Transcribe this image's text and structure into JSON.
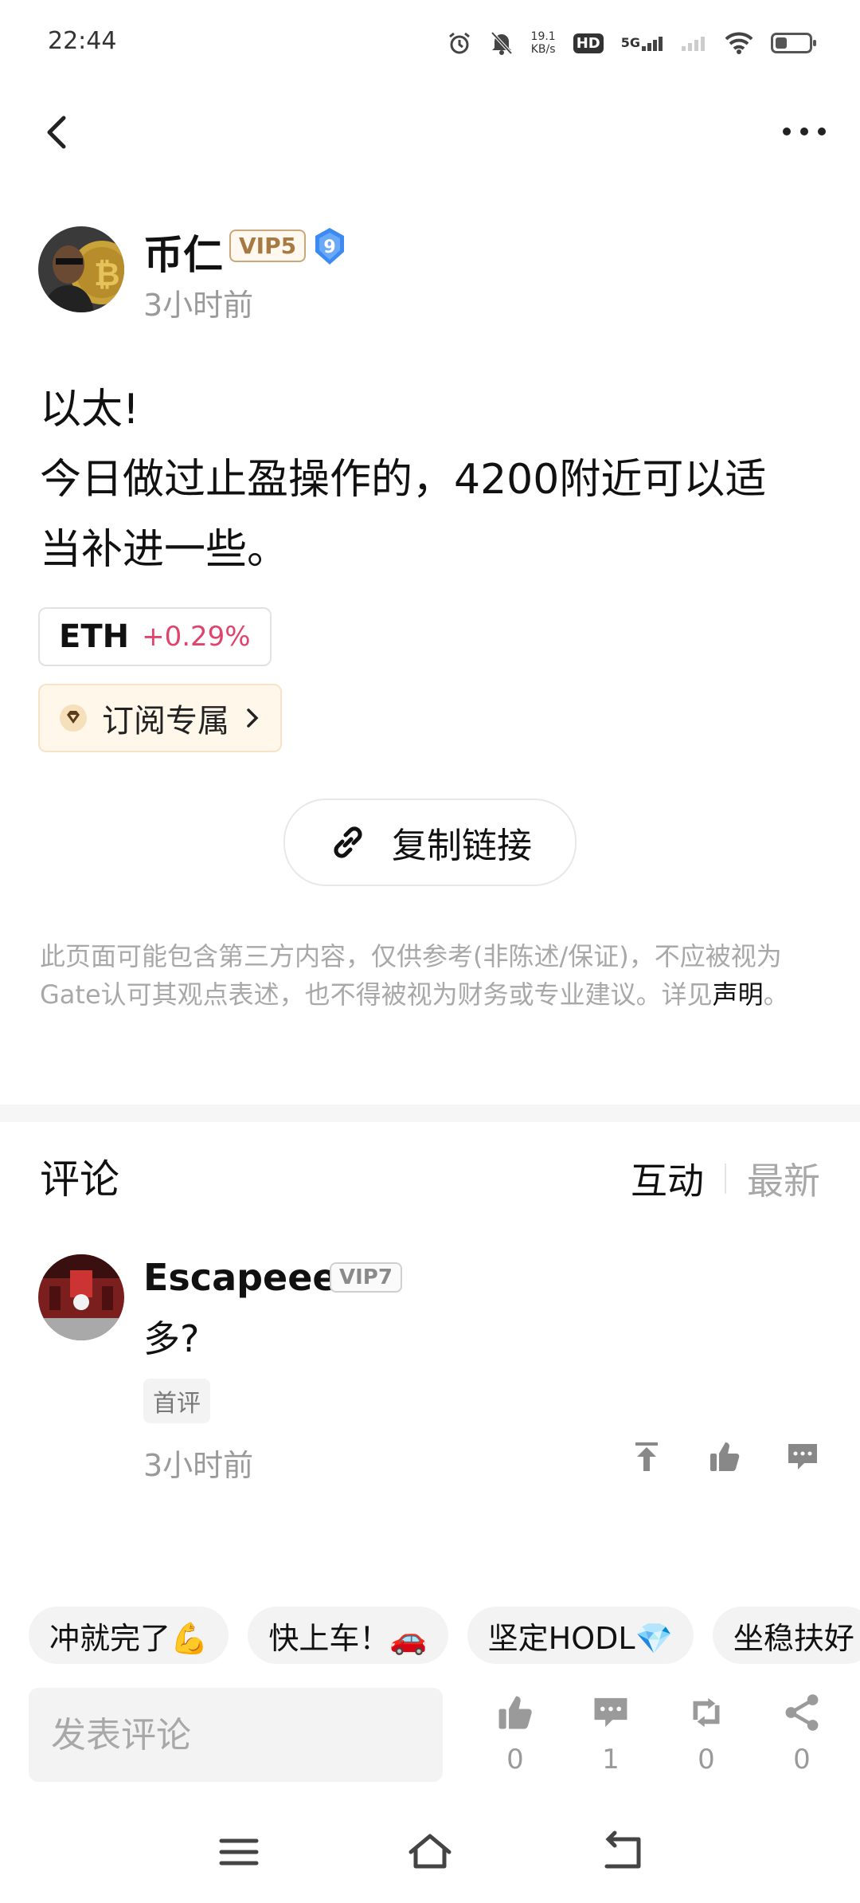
{
  "status_bar": {
    "time": "22:44",
    "net_speed_value": "19.1",
    "net_speed_unit": "KB/s",
    "hd_label": "HD",
    "network": "5G",
    "icons": [
      "alarm-icon",
      "mute-icon",
      "hd-icon",
      "signal-5g-icon",
      "signal-icon",
      "wifi-icon",
      "battery-icon"
    ]
  },
  "nav": {
    "back_icon": "chevron-left-icon",
    "more_icon": "more-dots-icon"
  },
  "post": {
    "author": {
      "name": "币仁",
      "vip": "VIP5",
      "level": "9"
    },
    "time": "3小时前",
    "lines": [
      "以太!",
      "今日做过止盈操作的，4200附近可以适",
      "当补进一些。"
    ],
    "token": {
      "symbol": "ETH",
      "change": "+0.29%"
    },
    "subscribe_label": "订阅专属",
    "copy_link_label": "复制链接"
  },
  "disclaimer": {
    "text": "此页面可能包含第三方内容，仅供参考(非陈述/保证)，不应被视为Gate认可其观点表述，也不得被视为财务或专业建议。详见",
    "link_text": "声明",
    "end": "。"
  },
  "comments": {
    "title": "评论",
    "sort_tabs": [
      {
        "label": "互动",
        "active": true
      },
      {
        "label": "最新",
        "active": false
      }
    ],
    "items": [
      {
        "name": "Escapeee",
        "vip": "VIP7",
        "text": "多?",
        "tag": "首评",
        "time": "3小时前"
      }
    ]
  },
  "quick_replies": [
    "冲就完了💪",
    "快上车！🚗",
    "坚定HODL💎",
    "坐稳扶好"
  ],
  "bottom_bar": {
    "input_placeholder": "发表评论",
    "stats": [
      {
        "icon": "thumb-up-icon",
        "count": "0"
      },
      {
        "icon": "comment-icon",
        "count": "1"
      },
      {
        "icon": "repost-icon",
        "count": "0"
      },
      {
        "icon": "share-icon",
        "count": "0"
      }
    ]
  },
  "colors": {
    "positive": "#e0436c",
    "muted": "#9a9a9a",
    "vip_gold": "#a77a43",
    "level_blue": "#3d8bf2"
  }
}
